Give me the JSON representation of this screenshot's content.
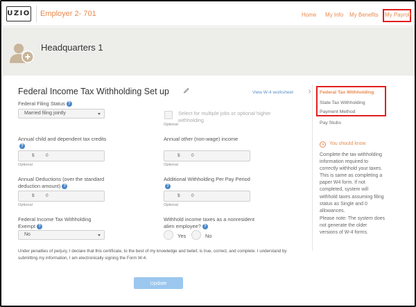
{
  "app": {
    "logo_text": "UZIO",
    "employer": "Employer 2- 701"
  },
  "topnav": {
    "home": "Home",
    "my_info": "My Info",
    "my_benefits": "My Benefits",
    "my_payroll": "My Payroll"
  },
  "header": {
    "location": "Headquarters 1"
  },
  "form": {
    "title": "Federal Income Tax Withholding Set up",
    "w4_link": "View W-4 worksheet",
    "filing_status_label": "Federal Filing Status",
    "filing_status_value": "Married filing jointly",
    "multiple_jobs_label": "Select for multiple jobs or optional higher withholding",
    "multiple_jobs_checked": false,
    "optional_text": "Optional",
    "child_credits_label": "Annual child and dependent tax credits",
    "child_credits_currency": "$",
    "child_credits_value": "0",
    "other_income_label": "Annual other (non-wage) income",
    "other_income_currency": "$",
    "other_income_value": "0",
    "deductions_label": "Annual Deductions (over the standard deduction amount)",
    "deductions_currency": "$",
    "deductions_value": "0",
    "additional_withholding_label": "Additional Withholding Per Pay Period",
    "additional_withholding_currency": "$",
    "additional_withholding_value": "0",
    "exempt_label": "Federal Income Tax Withholding Exempt",
    "exempt_value": "No",
    "nonresident_label": "Withhold income taxes as a nonresident alien employee?",
    "yes_label": "Yes",
    "no_label": "No",
    "disclaimer": "Under penalties of perjury, I declare that this certificate, to the best of my knowledge and belief, is true, correct, and complete. I understand by submitting my information, I am electronically signing the Form W-4.",
    "update_button": "Update",
    "help_icon_glyph": "?"
  },
  "sidebar": {
    "items": [
      {
        "label": "Federal Tax Withholding",
        "active": true
      },
      {
        "label": "State Tax Withholding",
        "active": false
      },
      {
        "label": "Payment Method",
        "active": false
      },
      {
        "label": "Pay Stubs",
        "active": false
      }
    ],
    "know_title": "You should know",
    "know_text": "Complete the tax withholding information required to correctly withhold your taxes. This is same as completing a paper W4 form. If not completed, system will withhold taxes assuming filing status as Single and 0 allowances.",
    "know_note": "Please note: The system does not generate the older versions of W-4 forms."
  },
  "colors": {
    "accent": "#e8884d",
    "highlight_box": "#e21d1d",
    "help_icon": "#4a86c8",
    "update_button": "#9cc7ee",
    "header_band": "#ededea"
  }
}
